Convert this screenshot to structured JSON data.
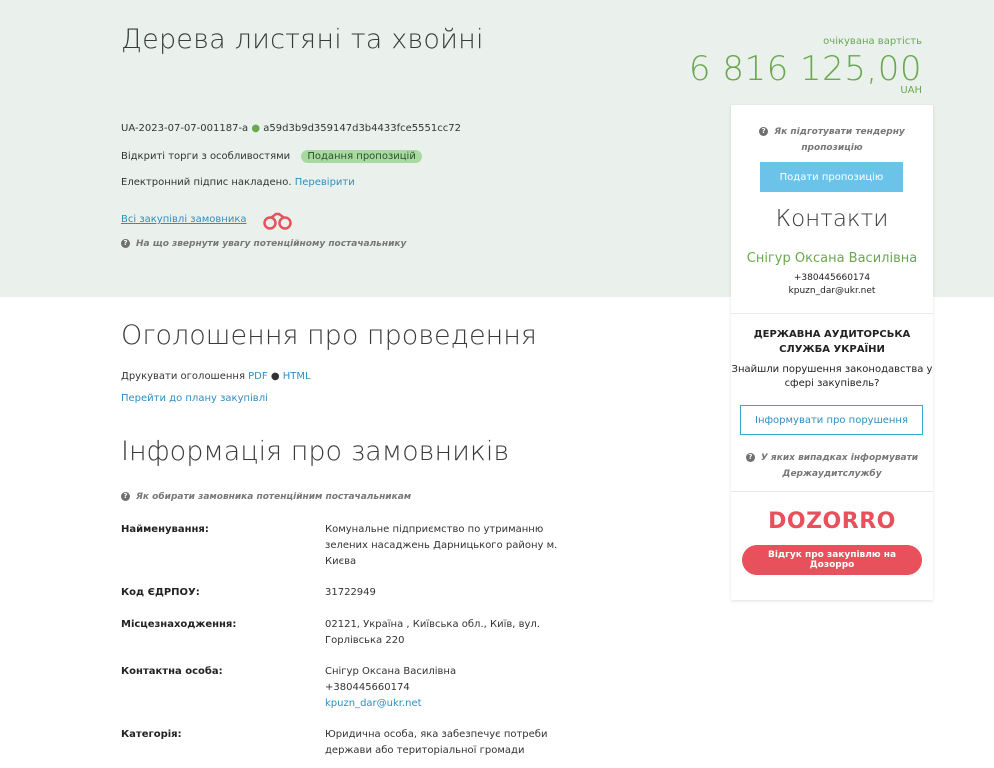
{
  "header": {
    "title": "Дерева листяні та хвойні",
    "price_label": "очікувана вартість",
    "price_value": "6 816 125,00",
    "currency": "UAH",
    "tender_id": "UA-2023-07-07-001187-a",
    "hash": "a59d3b9d359147d3b4433fce5551cc72",
    "procedure": "Відкриті торги з особливостями",
    "status_badge": "Подання пропозицій",
    "signature_text": "Електронний підпис накладено.",
    "signature_link": "Перевірити",
    "buyer_link": "Всі закупівлі замовника",
    "supplier_hint": "На що звернути увагу потенційному постачальнику"
  },
  "announcement": {
    "title": "Оголошення про проведення",
    "print_label": "Друкувати оголошення",
    "pdf_link": "PDF",
    "html_link": "HTML",
    "plan_link": "Перейти до плану закупівлі"
  },
  "customers": {
    "title": "Інформація про замовників",
    "hint": "Як обирати замовника потенційним постачальникам",
    "rows": [
      {
        "label": "Найменування:",
        "lines": [
          "Комунальне підприємство по утриманню",
          "зелених насаджень Дарницького району м.",
          "Києва"
        ]
      },
      {
        "label": "Код ЄДРПОУ:",
        "lines": [
          "31722949"
        ]
      },
      {
        "label": "Місцезнаходження:",
        "lines": [
          "02121, Україна , Київська обл., Київ, вул.",
          "Горлівська 220"
        ]
      },
      {
        "label": "Контактна особа:",
        "lines": [
          "Снігур Оксана Василівна",
          "+380445660174"
        ],
        "email": "kpuzn_dar@ukr.net"
      },
      {
        "label": "Категорія:",
        "lines": [
          "Юридична особа, яка забезпечує потреби",
          "держави або територіальної громади"
        ]
      }
    ]
  },
  "sidebar": {
    "how_to_hint": "Як підготувати тендерну пропозицію",
    "submit_button": "Подати пропозицію",
    "contacts_title": "Контакти",
    "contact_name": "Снігур Оксана Василівна",
    "contact_phone": "+380445660174",
    "contact_email": "kpuzn_dar@ukr.net",
    "audit_title": "ДЕРЖАВНА АУДИТОРСЬКА СЛУЖБА УКРАЇНИ",
    "audit_text": "Знайшли порушення законодавства у сфері закупівель?",
    "report_button": "Інформувати про порушення",
    "audit_hint": "У яких випадках інформувати Держаудитслужбу",
    "dozorro_logo": "DOZORRO",
    "dozorro_button": "Відгук про закупівлю на Дозорро"
  },
  "colors": {
    "accent_green": "#6aa84f",
    "link_blue": "#2f8ec0",
    "dozorro_red": "#e8505b",
    "submit_blue": "#6cc3ea"
  }
}
